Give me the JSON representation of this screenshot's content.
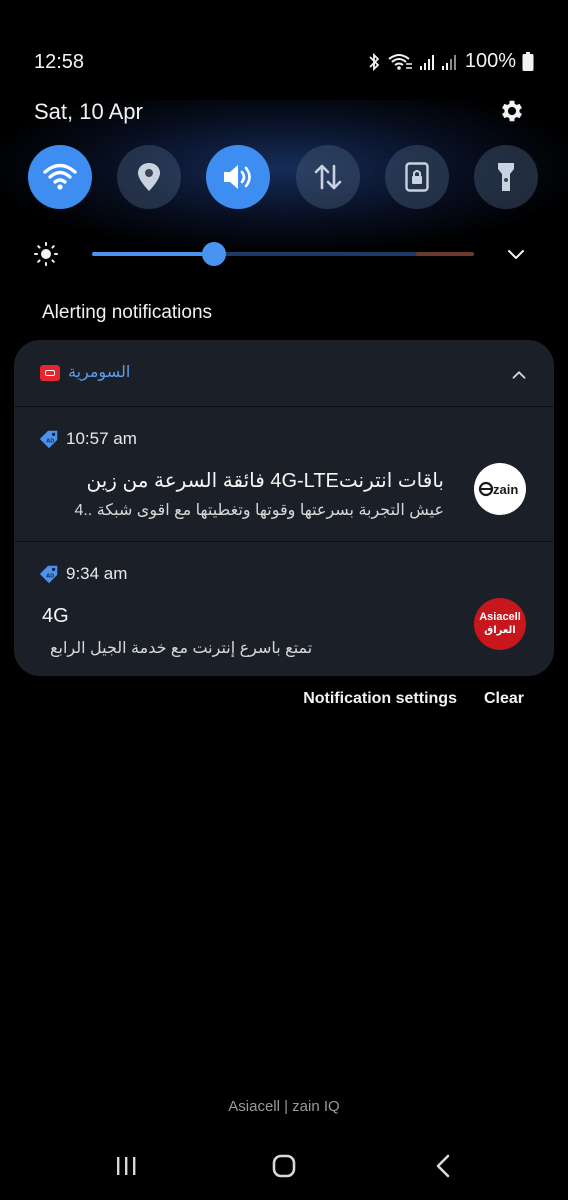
{
  "status_bar": {
    "time": "12:58",
    "battery": "100%",
    "icons": [
      "bluetooth-icon",
      "wifi-calling-icon",
      "signal-icon",
      "signal-icon-2",
      "battery-icon"
    ]
  },
  "header": {
    "date": "Sat, 10 Apr"
  },
  "quick_settings": [
    {
      "name": "wifi",
      "on": true
    },
    {
      "name": "location",
      "on": false
    },
    {
      "name": "sound",
      "on": true
    },
    {
      "name": "mobile-data",
      "on": false
    },
    {
      "name": "secure-folder",
      "on": false
    },
    {
      "name": "flashlight",
      "on": false
    }
  ],
  "brightness": {
    "level": 0.32
  },
  "section_title": "Alerting notifications",
  "notification_group": {
    "app_name": "السومرية",
    "items": [
      {
        "time": "10:57 am",
        "title": "باقات انترنت4G-LTE  فائقة السرعة من زين",
        "body": "عيش التجربة بسرعتها وقوتها وتغطيتها مع اقوى شبكة ..4",
        "avatar": "zain"
      },
      {
        "time": "9:34 am",
        "title": "4G",
        "body": "تمتع باسرع إنترنت مع خدمة الجيل الرابع",
        "avatar": "Asiacell"
      }
    ]
  },
  "actions": {
    "settings": "Notification settings",
    "clear": "Clear"
  },
  "carrier_label": "Asiacell | zain IQ",
  "colors": {
    "accent": "#3d8ef0",
    "card": "#1b2028",
    "brand_zain": "#1a1a1a",
    "brand_asiacell": "#c8161d"
  }
}
